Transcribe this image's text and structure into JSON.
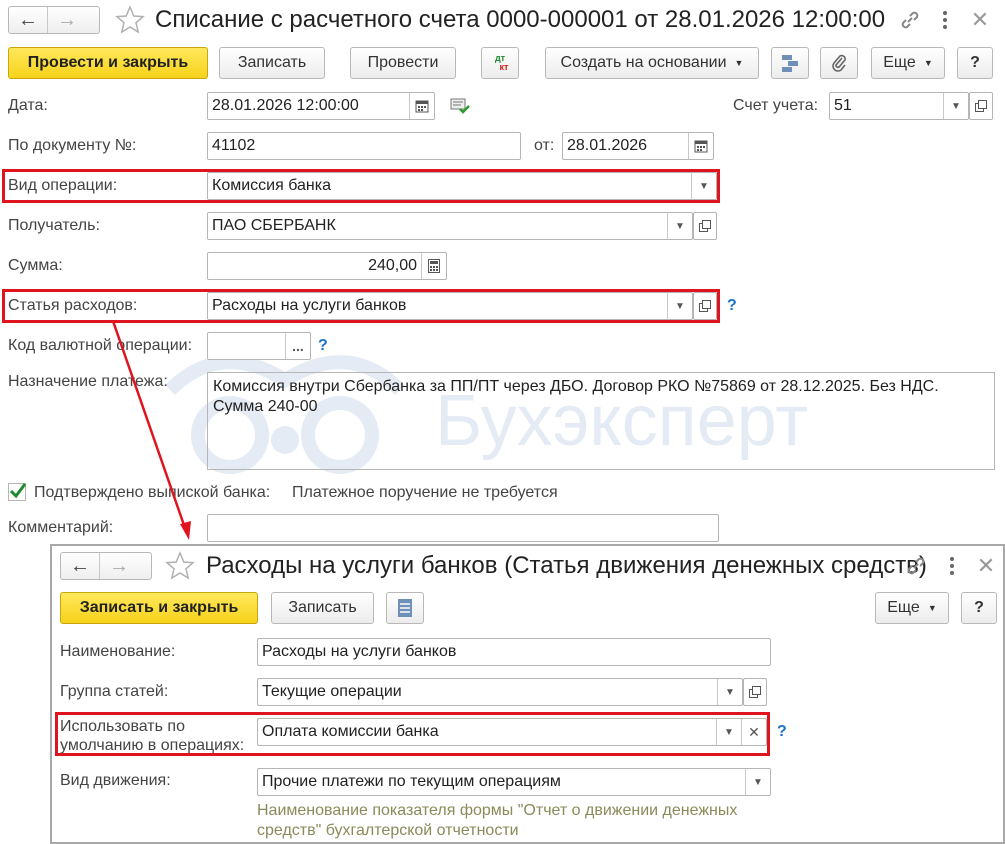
{
  "main": {
    "title": "Списание с расчетного счета 0000-000001 от 28.01.2026 12:00:00",
    "toolbar": {
      "post_and_close": "Провести и закрыть",
      "save": "Записать",
      "post": "Провести",
      "create_based_on": "Создать на основании",
      "more": "Еще",
      "help": "?"
    },
    "form": {
      "date_label": "Дата:",
      "date_value": "28.01.2026 12:00:00",
      "account_label": "Счет учета:",
      "account_value": "51",
      "doc_num_label": "По документу №:",
      "doc_num_value": "41102",
      "from_label": "от:",
      "from_value": "28.01.2026",
      "operation_label": "Вид операции:",
      "operation_value": "Комиссия банка",
      "recipient_label": "Получатель:",
      "recipient_value": "ПАО СБЕРБАНК",
      "amount_label": "Сумма:",
      "amount_value": "240,00",
      "expense_label": "Статья расходов:",
      "expense_value": "Расходы на услуги банков",
      "currency_code_label": "Код валютной операции:",
      "currency_code_value": "",
      "purpose_label": "Назначение платежа:",
      "purpose_value": "Комиссия внутри Сбербанка за ПП/ПТ через ДБО. Договор РКО №75869 от 28.12.2025. Без НДС. Сумма 240-00",
      "confirmed_label": "Подтверждено выпиской банка:",
      "payment_order_status": "Платежное поручение не требуется",
      "comment_label": "Комментарий:",
      "comment_value": ""
    }
  },
  "watermark": "Бухэксперт",
  "popup": {
    "title": "Расходы на услуги банков (Статья движения денежных средств)",
    "toolbar": {
      "save_and_close": "Записать и закрыть",
      "save": "Записать",
      "more": "Еще",
      "help": "?"
    },
    "form": {
      "name_label": "Наименование:",
      "name_value": "Расходы на услуги банков",
      "group_label": "Группа статей:",
      "group_value": "Текущие операции",
      "default_use_label_1": "Использовать по",
      "default_use_label_2": "умолчанию в операциях:",
      "default_use_value": "Оплата комиссии банка",
      "movement_label": "Вид движения:",
      "movement_value": "Прочие платежи по текущим операциям",
      "hint": "Наименование показателя формы \"Отчет о движении денежных средств\" бухгалтерской отчетности"
    }
  },
  "colors": {
    "highlight": "#e0141e",
    "primary_button": "#f6d21a",
    "help_link": "#1a72c8"
  }
}
